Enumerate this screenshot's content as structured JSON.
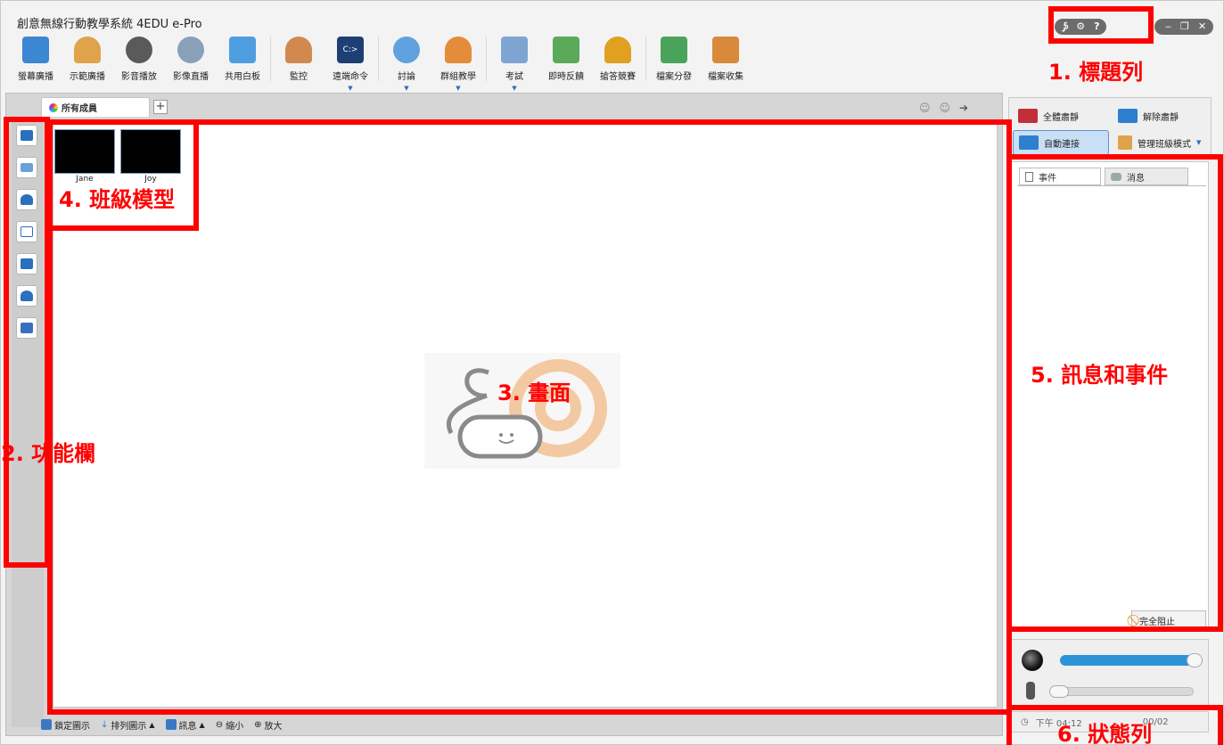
{
  "window": {
    "title": "創意無線行動教學系統 4EDU e-Pro"
  },
  "toolbar": {
    "items": [
      {
        "label": "螢幕廣播",
        "icon": "screen-broadcast-icon",
        "color": "#3b87d1"
      },
      {
        "label": "示範廣播",
        "icon": "demo-broadcast-icon",
        "color": "#e0a24a"
      },
      {
        "label": "影音播放",
        "icon": "film-reel-icon",
        "color": "#5a5a5a"
      },
      {
        "label": "影像直播",
        "icon": "webcam-icon",
        "color": "#8aa0b8"
      },
      {
        "label": "共用白板",
        "icon": "whiteboard-icon",
        "color": "#4f9fe0"
      },
      {
        "label": "監控",
        "icon": "monitor-person-icon",
        "color": "#d08a50"
      },
      {
        "label": "遠端命令",
        "icon": "command-prompt-icon",
        "color": "#1d3f74"
      },
      {
        "label": "討論",
        "icon": "chat-bubbles-icon",
        "color": "#5fa2de"
      },
      {
        "label": "群組教學",
        "icon": "group-users-icon",
        "color": "#e48c3a"
      },
      {
        "label": "考試",
        "icon": "exam-clock-icon",
        "color": "#7ea5d2"
      },
      {
        "label": "即時反饋",
        "icon": "feedback-bars-icon",
        "color": "#5aaa5a"
      },
      {
        "label": "搶答競賽",
        "icon": "quiz-star-icon",
        "color": "#e0a020"
      },
      {
        "label": "檔案分發",
        "icon": "file-send-icon",
        "color": "#4aa35a"
      },
      {
        "label": "檔案收集",
        "icon": "file-collect-icon",
        "color": "#d8893a"
      }
    ]
  },
  "tabs": {
    "all_members": "所有成員"
  },
  "students": [
    {
      "name": "Jane"
    },
    {
      "name": "Joy"
    }
  ],
  "statusbar": {
    "lock": "鎖定圖示",
    "sort": "排列圖示",
    "info": "訊息",
    "zoom_out": "縮小",
    "zoom_in": "放大"
  },
  "right_panel": {
    "mute_all": "全體肅靜",
    "unmute": "解除肅靜",
    "auto_connect": "自動連接",
    "manage_mode": "管理班級模式",
    "tab_events": "事件",
    "tab_messages": "消息",
    "block_all": "完全阻止",
    "status_time": "下午 04:12",
    "status_date": "00/02"
  },
  "annotations": {
    "title_bar": "1.  標題列",
    "function_bar": "2. 功能欄",
    "screen": "3. 畫面",
    "class_model": "4. 班級模型",
    "messages_events": "5. 訊息和事件",
    "status_bar": "6. 狀態列"
  },
  "colors": {
    "annotation_red": "#ff0000",
    "accent_blue": "#2c6fbd"
  }
}
